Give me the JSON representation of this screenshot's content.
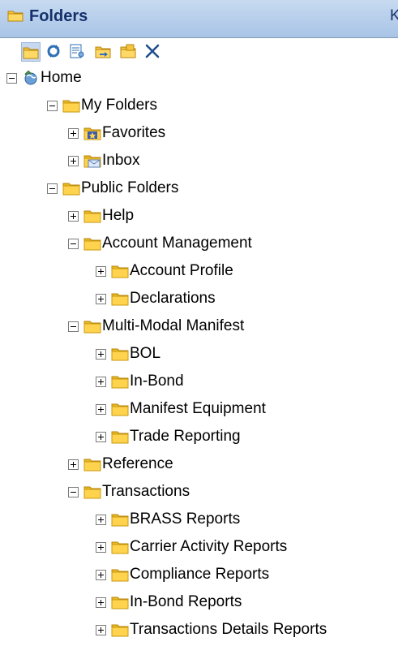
{
  "panel": {
    "title": "Folders",
    "title_extra": "K"
  },
  "toolbar": {
    "buttons": [
      {
        "name": "new-folder-button",
        "icon": "folder-icon"
      },
      {
        "name": "refresh-button",
        "icon": "refresh-icon"
      },
      {
        "name": "properties-button",
        "icon": "properties-icon"
      },
      {
        "name": "move-folder-button",
        "icon": "folder-move-icon"
      },
      {
        "name": "copy-folder-button",
        "icon": "folder-copy-icon"
      },
      {
        "name": "delete-button",
        "icon": "close-icon"
      }
    ]
  },
  "tree": {
    "nodes": [
      {
        "label": "Home",
        "level": 0,
        "expander": "minus",
        "icon": "home-icon"
      },
      {
        "label": "My Folders",
        "level": 1,
        "expander": "minus",
        "icon": "folder-icon"
      },
      {
        "label": "Favorites",
        "level": 2,
        "expander": "plus",
        "icon": "favorites-icon"
      },
      {
        "label": "Inbox",
        "level": 2,
        "expander": "plus",
        "icon": "inbox-icon"
      },
      {
        "label": "Public Folders",
        "level": 1,
        "expander": "minus",
        "icon": "folder-icon"
      },
      {
        "label": " Help",
        "level": 2,
        "expander": "plus",
        "icon": "folder-icon"
      },
      {
        "label": "Account Management",
        "level": 2,
        "expander": "minus",
        "icon": "folder-icon"
      },
      {
        "label": "Account Profile",
        "level": 3,
        "expander": "plus",
        "icon": "folder-icon"
      },
      {
        "label": "Declarations",
        "level": 3,
        "expander": "plus",
        "icon": "folder-icon"
      },
      {
        "label": "Multi-Modal Manifest",
        "level": 2,
        "expander": "minus",
        "icon": "folder-icon"
      },
      {
        "label": "BOL",
        "level": 3,
        "expander": "plus",
        "icon": "folder-icon"
      },
      {
        "label": "In-Bond",
        "level": 3,
        "expander": "plus",
        "icon": "folder-icon"
      },
      {
        "label": "Manifest Equipment",
        "level": 3,
        "expander": "plus",
        "icon": "folder-icon"
      },
      {
        "label": "Trade Reporting",
        "level": 3,
        "expander": "plus",
        "icon": "folder-icon"
      },
      {
        "label": "Reference",
        "level": 2,
        "expander": "plus",
        "icon": "folder-icon"
      },
      {
        "label": "Transactions",
        "level": 2,
        "expander": "minus",
        "icon": "folder-icon"
      },
      {
        "label": "BRASS Reports",
        "level": 3,
        "expander": "plus",
        "icon": "folder-icon"
      },
      {
        "label": "Carrier Activity Reports",
        "level": 3,
        "expander": "plus",
        "icon": "folder-icon"
      },
      {
        "label": "Compliance Reports",
        "level": 3,
        "expander": "plus",
        "icon": "folder-icon"
      },
      {
        "label": "In-Bond Reports",
        "level": 3,
        "expander": "plus",
        "icon": "folder-icon"
      },
      {
        "label": "Transactions Details Reports",
        "level": 3,
        "expander": "plus",
        "icon": "folder-icon"
      }
    ]
  }
}
